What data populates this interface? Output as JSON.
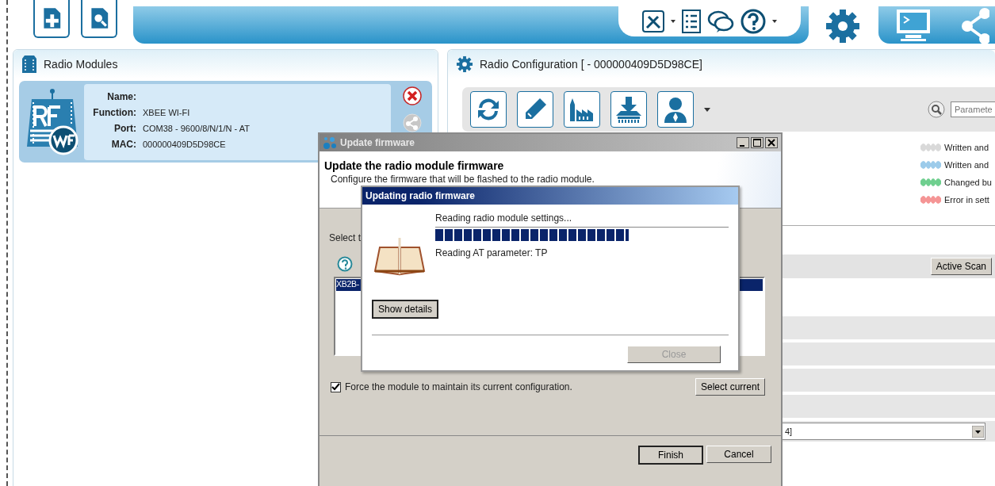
{
  "modules_panel": {
    "title": "Radio Modules",
    "module": {
      "fields": [
        {
          "label": "Name:"
        },
        {
          "label": "Function:",
          "value": "XBEE WI-FI"
        },
        {
          "label": "Port:",
          "value": "COM38 - 9600/8/N/1/N - AT"
        },
        {
          "label": "MAC:",
          "value": "000000409D5D98CE"
        }
      ]
    }
  },
  "config_panel": {
    "title": "Radio Configuration [  - 000000409D5D98CE]",
    "search": {
      "placeholder": "Paramete"
    },
    "legend": [
      {
        "label": "Written and",
        "color": "#d9d9d9"
      },
      {
        "label": "Written and",
        "color": "#9ccbea"
      },
      {
        "label": "Changed bu",
        "color": "#6fcf8f"
      },
      {
        "label": "Error in sett",
        "color": "#f59595"
      }
    ],
    "scan_button": "Active Scan",
    "dropdown": {
      "value": "4]"
    }
  },
  "firmware_dialog": {
    "title": "Update firmware",
    "heading": "Update the radio module firmware",
    "description": "Configure the firmware that will be flashed to the radio module.",
    "select_label": "Select t",
    "list": [
      {
        "label": "XB2B-",
        "selected": true
      }
    ],
    "force_checkbox": {
      "label": "Force the module to maintain its current configuration.",
      "checked": true
    },
    "select_current": "Select current",
    "buttons": [
      "Finish",
      "Cancel"
    ]
  },
  "progress_dialog": {
    "title": "Updating radio firmware",
    "status": "Reading radio module settings...",
    "level": 0.66,
    "detail": "Reading AT parameter: TP",
    "show_details": "Show details",
    "close": {
      "label": "Close",
      "disabled": true
    }
  }
}
